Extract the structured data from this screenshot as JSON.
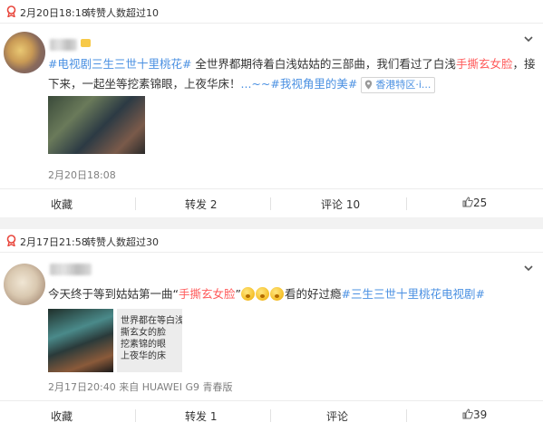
{
  "posts": [
    {
      "hot_date": "2月20日18:18",
      "hot_note": "转赞人数超过10",
      "segments": [
        {
          "text": "#电视剧三生三世十里桃花#",
          "type": "topic"
        },
        {
          "text": " 全世界都期待着白浅姑姑的三部曲，我们看过了白浅",
          "type": "plain"
        },
        {
          "text": "手撕玄女脸",
          "type": "hl"
        },
        {
          "text": "，接下来，一起坐等挖素锦眼，上夜华床！",
          "type": "plain"
        },
        {
          "text": "...~~",
          "type": "more"
        },
        {
          "text": "#我视角里的美#",
          "type": "topic"
        }
      ],
      "location": "香港特区·i...",
      "meta": "2月20日18:08",
      "actions": {
        "favorite": "收藏",
        "repost": "转发 2",
        "comment": "评论 10",
        "like": "25"
      }
    },
    {
      "hot_date": "2月17日21:58",
      "hot_note": "转赞人数超过30",
      "segments": [
        {
          "text": "今天终于等到姑姑第一曲“",
          "type": "plain"
        },
        {
          "text": "手撕玄女脸",
          "type": "hl"
        },
        {
          "text": "”",
          "type": "plain"
        },
        {
          "text": "",
          "type": "emoji3"
        },
        {
          "text": "看的好过瘾",
          "type": "plain"
        },
        {
          "text": "#三生三世十里桃花电视剧#",
          "type": "topic"
        }
      ],
      "image_text": [
        "世界都在等白浅姑",
        "撕玄女的脸",
        "挖素锦的眼",
        "上夜华的床"
      ],
      "meta": "2月17日20:40 来自 HUAWEI G9 青春版",
      "actions": {
        "favorite": "收藏",
        "repost": "转发 1",
        "comment": "评论",
        "like": "39"
      }
    }
  ],
  "colors": {
    "topic": "#4a90e2",
    "highlight": "#ff5a5a",
    "hot_icon": "#e8463c"
  }
}
